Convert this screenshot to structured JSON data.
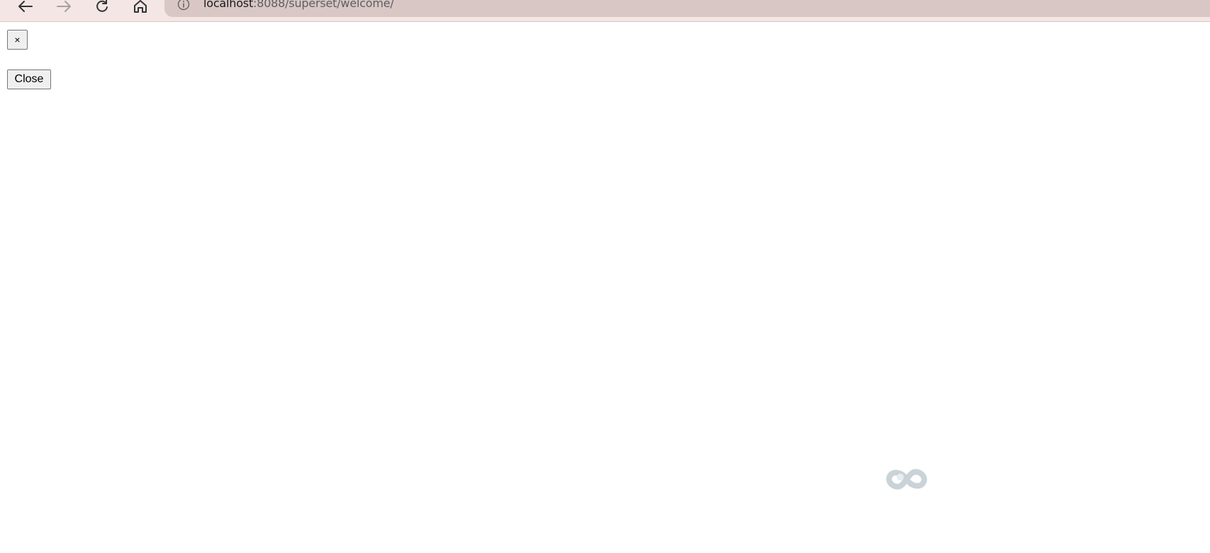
{
  "browser": {
    "url_host": "localhost",
    "url_rest": ":8088/superset/welcome/",
    "icons": [
      "back-arrow-icon",
      "forward-arrow-icon",
      "reload-icon",
      "home-icon",
      "info-icon"
    ]
  },
  "page": {
    "dismiss_label": "×",
    "close_label": "Close"
  },
  "colors": {
    "toolbar_bg": "#f3e6e5",
    "addressbar_bg": "#d9c7c6",
    "loader": "#c9d3d8"
  }
}
